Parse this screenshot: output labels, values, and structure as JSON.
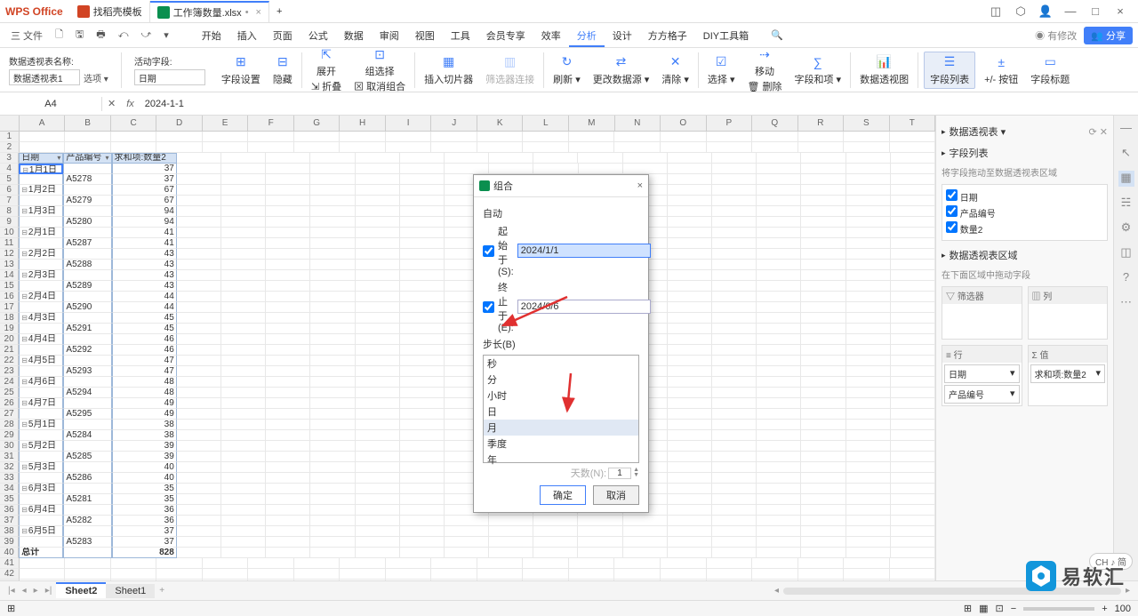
{
  "titlebar": {
    "brand": "WPS Office",
    "tabs": [
      {
        "icon": "#d14424",
        "label": "找稻壳模板"
      },
      {
        "icon": "#0a8f4f",
        "label": "工作簿数量.xlsx",
        "active": true,
        "dirty": "•"
      }
    ],
    "newtab": "+"
  },
  "menubar": {
    "file": "三 文件",
    "quick": [
      "🗋",
      "🖫",
      "🖶",
      "⤺",
      "⤻",
      "▾"
    ],
    "tabs": [
      "开始",
      "插入",
      "页面",
      "公式",
      "数据",
      "审阅",
      "视图",
      "工具",
      "会员专享",
      "效率",
      "分析",
      "设计",
      "方方格子",
      "DIY工具箱"
    ],
    "active": "分析",
    "search": "🔍",
    "modified": "◉ 有修改",
    "share": "👥 分享"
  },
  "ribbon": {
    "g1": {
      "l1": "数据透视表名称:",
      "v1": "数据透视表1",
      "l2": "选项 ▾"
    },
    "g2": {
      "l1": "活动字段:",
      "v1": "日期"
    },
    "btns": [
      {
        "ico": "⊞",
        "label": "字段设置"
      },
      {
        "ico": "⊟",
        "label": "隐藏"
      },
      {
        "ico": "⇱",
        "label": "展开",
        "stack": "⇲ 折叠"
      },
      {
        "ico": "⊡",
        "label": "组选择",
        "stack": "⊠ 取消组合"
      },
      {
        "ico": "▦",
        "label": "插入切片器"
      },
      {
        "ico": "▥",
        "label": "筛选器连接",
        "dim": true
      },
      {
        "ico": "↻",
        "label": "刷新 ▾"
      },
      {
        "ico": "⇄",
        "label": "更改数据源 ▾"
      },
      {
        "ico": "✕",
        "label": "清除 ▾"
      },
      {
        "ico": "☑",
        "label": "选择 ▾"
      },
      {
        "ico": "⇢",
        "label": "移动",
        "stack": "🗑 删除"
      },
      {
        "ico": "∑",
        "label": "字段和项 ▾"
      },
      {
        "ico": "📊",
        "label": "数据透视图"
      },
      {
        "ico": "☰",
        "label": "字段列表",
        "hl": true
      },
      {
        "ico": "±",
        "label": "+/- 按钮"
      },
      {
        "ico": "▭",
        "label": "字段标题"
      }
    ]
  },
  "formula": {
    "name": "A4",
    "fx": "fx",
    "value": "2024-1-1"
  },
  "cols": [
    "A",
    "B",
    "C",
    "D",
    "E",
    "F",
    "G",
    "H",
    "I",
    "J",
    "K",
    "L",
    "M",
    "N",
    "O",
    "P",
    "Q",
    "R",
    "S",
    "T"
  ],
  "pivot": {
    "h1": "日期",
    "h2": "产品编号",
    "h3": "求和项:数量2",
    "rows": [
      [
        "⊟1月1日",
        "",
        "37"
      ],
      [
        "",
        "A5278",
        "37"
      ],
      [
        "⊟1月2日",
        "",
        "67"
      ],
      [
        "",
        "A5279",
        "67"
      ],
      [
        "⊟1月3日",
        "",
        "94"
      ],
      [
        "",
        "A5280",
        "94"
      ],
      [
        "⊟2月1日",
        "",
        "41"
      ],
      [
        "",
        "A5287",
        "41"
      ],
      [
        "⊟2月2日",
        "",
        "43"
      ],
      [
        "",
        "A5288",
        "43"
      ],
      [
        "⊟2月3日",
        "",
        "43"
      ],
      [
        "",
        "A5289",
        "43"
      ],
      [
        "⊟2月4日",
        "",
        "44"
      ],
      [
        "",
        "A5290",
        "44"
      ],
      [
        "⊟4月3日",
        "",
        "45"
      ],
      [
        "",
        "A5291",
        "45"
      ],
      [
        "⊟4月4日",
        "",
        "46"
      ],
      [
        "",
        "A5292",
        "46"
      ],
      [
        "⊟4月5日",
        "",
        "47"
      ],
      [
        "",
        "A5293",
        "47"
      ],
      [
        "⊟4月6日",
        "",
        "48"
      ],
      [
        "",
        "A5294",
        "48"
      ],
      [
        "⊟4月7日",
        "",
        "49"
      ],
      [
        "",
        "A5295",
        "49"
      ],
      [
        "⊟5月1日",
        "",
        "38"
      ],
      [
        "",
        "A5284",
        "38"
      ],
      [
        "⊟5月2日",
        "",
        "39"
      ],
      [
        "",
        "A5285",
        "39"
      ],
      [
        "⊟5月3日",
        "",
        "40"
      ],
      [
        "",
        "A5286",
        "40"
      ],
      [
        "⊟6月3日",
        "",
        "35"
      ],
      [
        "",
        "A5281",
        "35"
      ],
      [
        "⊟6月4日",
        "",
        "36"
      ],
      [
        "",
        "A5282",
        "36"
      ],
      [
        "⊟6月5日",
        "",
        "37"
      ],
      [
        "",
        "A5283",
        "37"
      ],
      [
        "总计",
        "",
        "828"
      ]
    ]
  },
  "dialog": {
    "title": "组合",
    "auto": "自动",
    "start": "起始于(S):",
    "startv": "2024/1/1",
    "end": "终止于(E):",
    "endv": "2024/6/6",
    "step": "步长(B)",
    "items": [
      "秒",
      "分",
      "小时",
      "日",
      "月",
      "季度",
      "年"
    ],
    "sel": "月",
    "days": "天数(N):",
    "daysval": "1",
    "ok": "确定",
    "cancel": "取消"
  },
  "sidebar": {
    "title": "数据透视表 ▾",
    "fields": "字段列表",
    "hint": "将字段拖动至数据透视表区域",
    "flds": [
      {
        "n": "日期",
        "c": true
      },
      {
        "n": "产品编号",
        "c": true
      },
      {
        "n": "数量2",
        "c": true
      }
    ],
    "areatitle": "数据透视表区域",
    "areahint": "在下面区域中拖动字段",
    "filter": "▽ 筛选器",
    "col": "▥ 列",
    "row": "≡ 行",
    "val": "Σ 值",
    "rowitems": [
      "日期",
      "产品编号"
    ],
    "valitems": [
      "求和项:数量2"
    ]
  },
  "sheettabs": {
    "tabs": [
      "Sheet2",
      "Sheet1"
    ],
    "active": "Sheet2"
  },
  "status": {
    "zoom": "100",
    "ch": "CH ♪ 简"
  },
  "watermark": "易软汇"
}
